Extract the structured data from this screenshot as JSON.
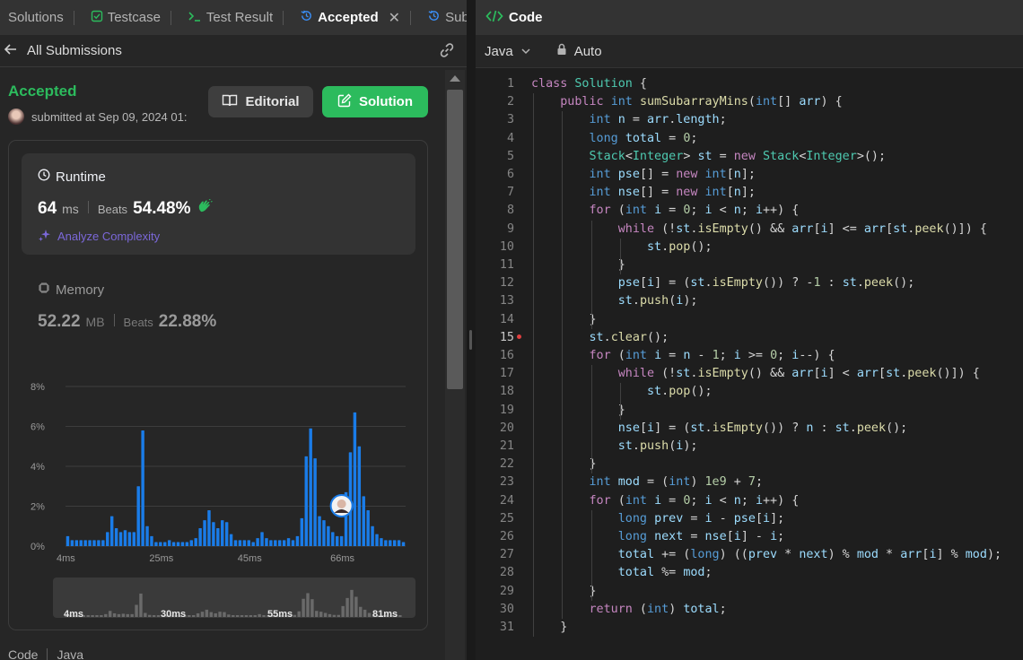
{
  "tabs": [
    {
      "label": "Solutions",
      "icon": "none"
    },
    {
      "label": "Testcase",
      "icon": "checkbox-icon"
    },
    {
      "label": "Test Result",
      "icon": "terminal-icon"
    },
    {
      "label": "Accepted",
      "icon": "history-icon",
      "active": true
    },
    {
      "label": "Submi",
      "icon": "history-icon"
    }
  ],
  "submissions": {
    "back_label": "All Submissions"
  },
  "result": {
    "status": "Accepted",
    "submitted_text": "submitted at Sep 09, 2024 01:",
    "editorial_label": "Editorial",
    "solution_label": "Solution"
  },
  "runtime": {
    "title": "Runtime",
    "value": "64",
    "unit": "ms",
    "beats_label": "Beats",
    "beats_value": "54.48%",
    "analyze_label": "Analyze Complexity"
  },
  "memory": {
    "title": "Memory",
    "value": "52.22",
    "unit": "MB",
    "beats_label": "Beats",
    "beats_value": "22.88%"
  },
  "chart_data": {
    "type": "bar",
    "ylim": [
      0,
      8
    ],
    "yticks": [
      "8%",
      "6%",
      "4%",
      "2%",
      "0%"
    ],
    "xticks": [
      {
        "label": "4ms",
        "index": 0
      },
      {
        "label": "25ms",
        "index": 21
      },
      {
        "label": "45ms",
        "index": 41
      },
      {
        "label": "66ms",
        "index": 62
      }
    ],
    "values": [
      0.5,
      0.3,
      0.3,
      0.3,
      0.3,
      0.3,
      0.3,
      0.3,
      0.3,
      0.7,
      1.5,
      0.9,
      0.7,
      0.8,
      0.7,
      0.7,
      3.0,
      5.8,
      1.0,
      0.5,
      0.2,
      0.2,
      0.2,
      0.3,
      0.2,
      0.2,
      0.2,
      0.2,
      0.3,
      0.4,
      0.9,
      1.3,
      1.8,
      1.2,
      0.9,
      1.3,
      1.2,
      0.6,
      0.3,
      0.3,
      0.3,
      0.3,
      0.2,
      0.4,
      0.7,
      0.4,
      0.3,
      0.3,
      0.3,
      0.3,
      0.4,
      0.3,
      0.5,
      1.4,
      4.5,
      5.9,
      4.4,
      1.5,
      1.3,
      1.0,
      0.7,
      0.5,
      0.5,
      2.7,
      4.7,
      6.7,
      5.0,
      2.5,
      1.8,
      1.0,
      0.6,
      0.4,
      0.3,
      0.3,
      0.3,
      0.3,
      0.2
    ],
    "highlight_index": 62,
    "overview_labels": [
      "4ms",
      "30ms",
      "55ms",
      "81ms"
    ]
  },
  "footer": {
    "code_label": "Code",
    "lang": "Java"
  },
  "editor": {
    "title": "Code",
    "language": "Java",
    "mode": "Auto",
    "lines": [
      "class Solution {",
      "    public int sumSubarrayMins(int[] arr) {",
      "        int n = arr.length;",
      "        long total = 0;",
      "        Stack<Integer> st = new Stack<Integer>();",
      "        int pse[] = new int[n];",
      "        int nse[] = new int[n];",
      "        for (int i = 0; i < n; i++) {",
      "            while (!st.isEmpty() && arr[i] <= arr[st.peek()]) {",
      "                st.pop();",
      "            }",
      "            pse[i] = (st.isEmpty()) ? -1 : st.peek();",
      "            st.push(i);",
      "        }",
      "        st.clear();",
      "        for (int i = n - 1; i >= 0; i--) {",
      "            while (!st.isEmpty() && arr[i] < arr[st.peek()]) {",
      "                st.pop();",
      "            }",
      "            nse[i] = (st.isEmpty()) ? n : st.peek();",
      "            st.push(i);",
      "        }",
      "        int mod = (int) 1e9 + 7;",
      "        for (int i = 0; i < n; i++) {",
      "            long prev = i - pse[i];",
      "            long next = nse[i] - i;",
      "            total += (long) ((prev * next) % mod * arr[i] % mod);",
      "            total %= mod;",
      "        }",
      "        return (int) total;",
      "    }"
    ],
    "breakpoint_line": 15
  },
  "colors": {
    "accent_green": "#2cbb5d",
    "bar_blue": "#1a7ce8",
    "analyze_purple": "#7b68d9"
  }
}
